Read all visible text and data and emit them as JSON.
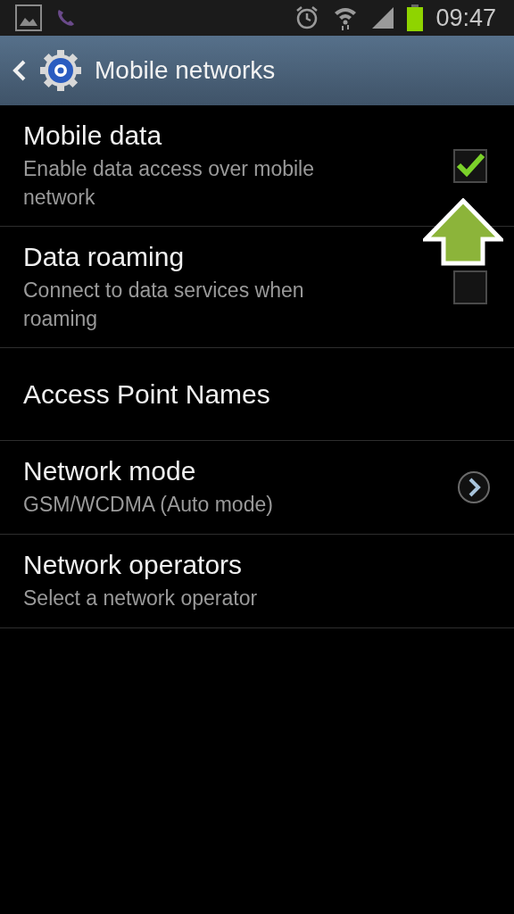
{
  "status_bar": {
    "time": "09:47"
  },
  "action_bar": {
    "title": "Mobile networks"
  },
  "settings": [
    {
      "kind": "checkbox",
      "title": "Mobile data",
      "summary": "Enable data access over mobile network",
      "checked": true
    },
    {
      "kind": "checkbox",
      "title": "Data roaming",
      "summary": "Connect to data services when roaming",
      "checked": false
    },
    {
      "kind": "plain",
      "title": "Access Point Names"
    },
    {
      "kind": "detail",
      "title": "Network mode",
      "summary": "GSM/WCDMA (Auto mode)"
    },
    {
      "kind": "plain",
      "title": "Network operators",
      "summary": "Select a network operator"
    }
  ]
}
